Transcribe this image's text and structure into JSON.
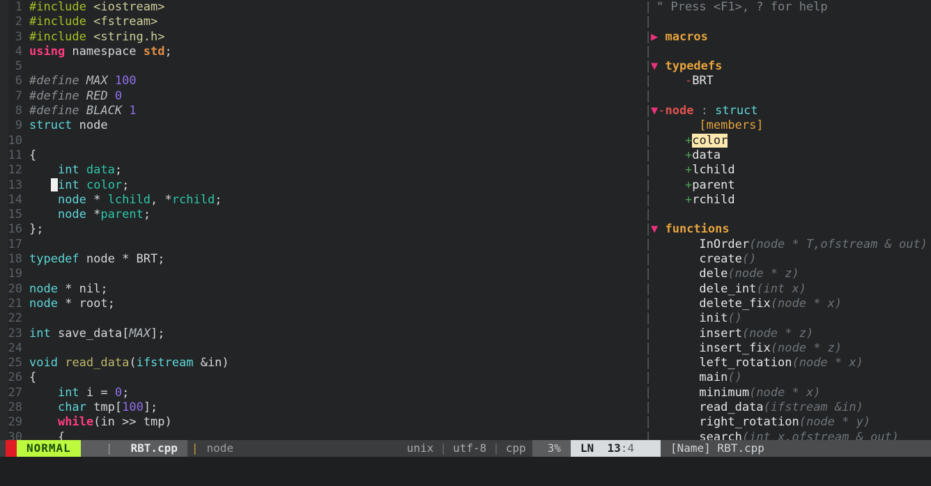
{
  "app": {
    "name": "vim",
    "filename": "RBT.cpp"
  },
  "editor": {
    "cursor_line": 13,
    "cursor_col": 4,
    "lines": [
      {
        "n": "1",
        "tokens": [
          {
            "t": "#include ",
            "c": "s-pre"
          },
          {
            "t": "<iostream>",
            "c": "s-str"
          }
        ]
      },
      {
        "n": "2",
        "tokens": [
          {
            "t": "#include ",
            "c": "s-pre"
          },
          {
            "t": "<fstream>",
            "c": "s-str"
          }
        ]
      },
      {
        "n": "3",
        "tokens": [
          {
            "t": "#include ",
            "c": "s-pre"
          },
          {
            "t": "<string.h>",
            "c": "s-str"
          }
        ]
      },
      {
        "n": "4",
        "tokens": [
          {
            "t": "using",
            "c": "s-kw"
          },
          {
            "t": " namespace ",
            "c": "s-plain"
          },
          {
            "t": "std",
            "c": "s-type"
          },
          {
            "t": ";",
            "c": "s-punct"
          }
        ]
      },
      {
        "n": "5",
        "tokens": []
      },
      {
        "n": "6",
        "tokens": [
          {
            "t": "#define ",
            "c": "s-cmt"
          },
          {
            "t": "MAX",
            "c": "s-cmtid"
          },
          {
            "t": " ",
            "c": "s-cmt"
          },
          {
            "t": "100",
            "c": "s-num"
          }
        ]
      },
      {
        "n": "7",
        "tokens": [
          {
            "t": "#define ",
            "c": "s-cmt"
          },
          {
            "t": "RED",
            "c": "s-cmtid"
          },
          {
            "t": " ",
            "c": "s-cmt"
          },
          {
            "t": "0",
            "c": "s-num"
          }
        ]
      },
      {
        "n": "8",
        "tokens": [
          {
            "t": "#define ",
            "c": "s-cmt"
          },
          {
            "t": "BLACK",
            "c": "s-cmtid"
          },
          {
            "t": " ",
            "c": "s-cmt"
          },
          {
            "t": "1",
            "c": "s-num"
          }
        ]
      },
      {
        "n": "9",
        "tokens": [
          {
            "t": "struct",
            "c": "s-typ2"
          },
          {
            "t": " node",
            "c": "s-plain"
          }
        ]
      },
      {
        "n": "10",
        "tokens": []
      },
      {
        "n": "11",
        "tokens": [
          {
            "t": "{",
            "c": "s-plain"
          }
        ]
      },
      {
        "n": "12",
        "tokens": [
          {
            "t": "    ",
            "c": "s-plain"
          },
          {
            "t": "int",
            "c": "s-typ2"
          },
          {
            "t": " ",
            "c": "s-plain"
          },
          {
            "t": "data",
            "c": "s-id"
          },
          {
            "t": ";",
            "c": "s-punct"
          }
        ]
      },
      {
        "n": "13",
        "cursor_at": 3,
        "tokens": [
          {
            "t": "   ",
            "c": "s-plain"
          },
          {
            "t": "int",
            "c": "s-typ2"
          },
          {
            "t": " ",
            "c": "s-plain"
          },
          {
            "t": "color",
            "c": "s-id"
          },
          {
            "t": ";",
            "c": "s-punct"
          }
        ]
      },
      {
        "n": "14",
        "tokens": [
          {
            "t": "    ",
            "c": "s-plain"
          },
          {
            "t": "node",
            "c": "s-typ2"
          },
          {
            "t": " * ",
            "c": "s-plain"
          },
          {
            "t": "lchild",
            "c": "s-id"
          },
          {
            "t": ", *",
            "c": "s-plain"
          },
          {
            "t": "rchild",
            "c": "s-id"
          },
          {
            "t": ";",
            "c": "s-punct"
          }
        ]
      },
      {
        "n": "15",
        "tokens": [
          {
            "t": "    ",
            "c": "s-plain"
          },
          {
            "t": "node",
            "c": "s-typ2"
          },
          {
            "t": " *",
            "c": "s-plain"
          },
          {
            "t": "parent",
            "c": "s-id"
          },
          {
            "t": ";",
            "c": "s-punct"
          }
        ]
      },
      {
        "n": "16",
        "tokens": [
          {
            "t": "};",
            "c": "s-plain"
          }
        ]
      },
      {
        "n": "17",
        "tokens": []
      },
      {
        "n": "18",
        "tokens": [
          {
            "t": "typedef",
            "c": "s-typ2"
          },
          {
            "t": " node * ",
            "c": "s-plain"
          },
          {
            "t": "BRT",
            "c": "s-plain"
          },
          {
            "t": ";",
            "c": "s-punct"
          }
        ]
      },
      {
        "n": "19",
        "tokens": []
      },
      {
        "n": "20",
        "tokens": [
          {
            "t": "node",
            "c": "s-typ2"
          },
          {
            "t": " * ",
            "c": "s-plain"
          },
          {
            "t": "nil",
            "c": "s-plain"
          },
          {
            "t": ";",
            "c": "s-punct"
          }
        ]
      },
      {
        "n": "21",
        "tokens": [
          {
            "t": "node",
            "c": "s-typ2"
          },
          {
            "t": " * ",
            "c": "s-plain"
          },
          {
            "t": "root",
            "c": "s-plain"
          },
          {
            "t": ";",
            "c": "s-punct"
          }
        ]
      },
      {
        "n": "22",
        "tokens": []
      },
      {
        "n": "23",
        "tokens": [
          {
            "t": "int",
            "c": "s-typ2"
          },
          {
            "t": " save_data[",
            "c": "s-plain"
          },
          {
            "t": "MAX",
            "c": "s-cmtid"
          },
          {
            "t": "];",
            "c": "s-plain"
          }
        ]
      },
      {
        "n": "24",
        "tokens": []
      },
      {
        "n": "25",
        "tokens": [
          {
            "t": "void",
            "c": "s-typ2"
          },
          {
            "t": " ",
            "c": "s-plain"
          },
          {
            "t": "read_data",
            "c": "s-fn"
          },
          {
            "t": "(",
            "c": "s-plain"
          },
          {
            "t": "ifstream",
            "c": "s-typ2"
          },
          {
            "t": " &in)",
            "c": "s-plain"
          }
        ]
      },
      {
        "n": "26",
        "tokens": [
          {
            "t": "{",
            "c": "s-plain"
          }
        ]
      },
      {
        "n": "27",
        "tokens": [
          {
            "t": "    ",
            "c": "s-plain"
          },
          {
            "t": "int",
            "c": "s-typ2"
          },
          {
            "t": " i = ",
            "c": "s-plain"
          },
          {
            "t": "0",
            "c": "s-num"
          },
          {
            "t": ";",
            "c": "s-punct"
          }
        ]
      },
      {
        "n": "28",
        "tokens": [
          {
            "t": "    ",
            "c": "s-plain"
          },
          {
            "t": "char",
            "c": "s-typ2"
          },
          {
            "t": " tmp[",
            "c": "s-plain"
          },
          {
            "t": "100",
            "c": "s-num"
          },
          {
            "t": "];",
            "c": "s-plain"
          }
        ]
      },
      {
        "n": "29",
        "tokens": [
          {
            "t": "    ",
            "c": "s-plain"
          },
          {
            "t": "while",
            "c": "s-kw"
          },
          {
            "t": "(in >> tmp)",
            "c": "s-plain"
          }
        ]
      },
      {
        "n": "30",
        "tokens": [
          {
            "t": "    {",
            "c": "s-plain"
          }
        ]
      }
    ]
  },
  "tagbar": {
    "help_text": "\" Press <F1>, ? for help",
    "rows": [
      {
        "type": "help",
        "text": "\" Press <F1>, ? for help"
      },
      {
        "type": "blank"
      },
      {
        "type": "kind",
        "arrow": "▶",
        "label": "macros",
        "expanded": false
      },
      {
        "type": "blank"
      },
      {
        "type": "kind",
        "arrow": "▼",
        "label": "typedefs",
        "expanded": true
      },
      {
        "type": "entry",
        "prefix": "-",
        "label": "BRT",
        "indent": 4,
        "prefix_class": "t-dash"
      },
      {
        "type": "blank"
      },
      {
        "type": "scope",
        "arrow": "▼",
        "dash": "-",
        "label": "node",
        "colon": " : ",
        "kindname": "struct"
      },
      {
        "type": "members",
        "label": "[members]",
        "indent": 6
      },
      {
        "type": "entry",
        "prefix": "+",
        "label": "color",
        "indent": 4,
        "prefix_class": "t-plus",
        "highlighted": true
      },
      {
        "type": "entry",
        "prefix": "+",
        "label": "data",
        "indent": 4,
        "prefix_class": "t-plus"
      },
      {
        "type": "entry",
        "prefix": "+",
        "label": "lchild",
        "indent": 4,
        "prefix_class": "t-plus"
      },
      {
        "type": "entry",
        "prefix": "+",
        "label": "parent",
        "indent": 4,
        "prefix_class": "t-plus"
      },
      {
        "type": "entry",
        "prefix": "+",
        "label": "rchild",
        "indent": 4,
        "prefix_class": "t-plus"
      },
      {
        "type": "blank"
      },
      {
        "type": "kind",
        "arrow": "▼",
        "label": "functions",
        "expanded": true
      },
      {
        "type": "func",
        "label": "InOrder",
        "sig": "(node * T,ofstream & out)",
        "indent": 6
      },
      {
        "type": "func",
        "label": "create",
        "sig": "()",
        "indent": 6
      },
      {
        "type": "func",
        "label": "dele",
        "sig": "(node * z)",
        "indent": 6
      },
      {
        "type": "func",
        "label": "dele_int",
        "sig": "(int x)",
        "indent": 6
      },
      {
        "type": "func",
        "label": "delete_fix",
        "sig": "(node * x)",
        "indent": 6
      },
      {
        "type": "func",
        "label": "init",
        "sig": "()",
        "indent": 6
      },
      {
        "type": "func",
        "label": "insert",
        "sig": "(node * z)",
        "indent": 6
      },
      {
        "type": "func",
        "label": "insert_fix",
        "sig": "(node * z)",
        "indent": 6
      },
      {
        "type": "func",
        "label": "left_rotation",
        "sig": "(node * x)",
        "indent": 6
      },
      {
        "type": "func",
        "label": "main",
        "sig": "()",
        "indent": 6
      },
      {
        "type": "func",
        "label": "minimum",
        "sig": "(node * x)",
        "indent": 6
      },
      {
        "type": "func",
        "label": "read_data",
        "sig": "(ifstream &in)",
        "indent": 6
      },
      {
        "type": "func",
        "label": "right_rotation",
        "sig": "(node * y)",
        "indent": 6
      },
      {
        "type": "func",
        "label": "search",
        "sig": "(int x,ofstream & out)",
        "indent": 6
      }
    ]
  },
  "statusline": {
    "mode": "NORMAL",
    "filename": "RBT.cpp",
    "context": "node",
    "fileformat": "unix",
    "encoding": "utf-8",
    "filetype": "cpp",
    "separator": "|",
    "percent": "3%",
    "position_label": "LN",
    "line": "13",
    "col_sep": ":",
    "col": "4",
    "tagbar_status": "[Name] RBT.cpp"
  },
  "colors": {
    "background": "#222426",
    "mode_bg": "#bdfa3f",
    "mode_fg": "#1a4d0e",
    "accent_red": "#e01b24",
    "highlight_bg": "#ffe9ae",
    "cursor": "#f0f0f0",
    "orange_sep": "#cf9a36"
  }
}
